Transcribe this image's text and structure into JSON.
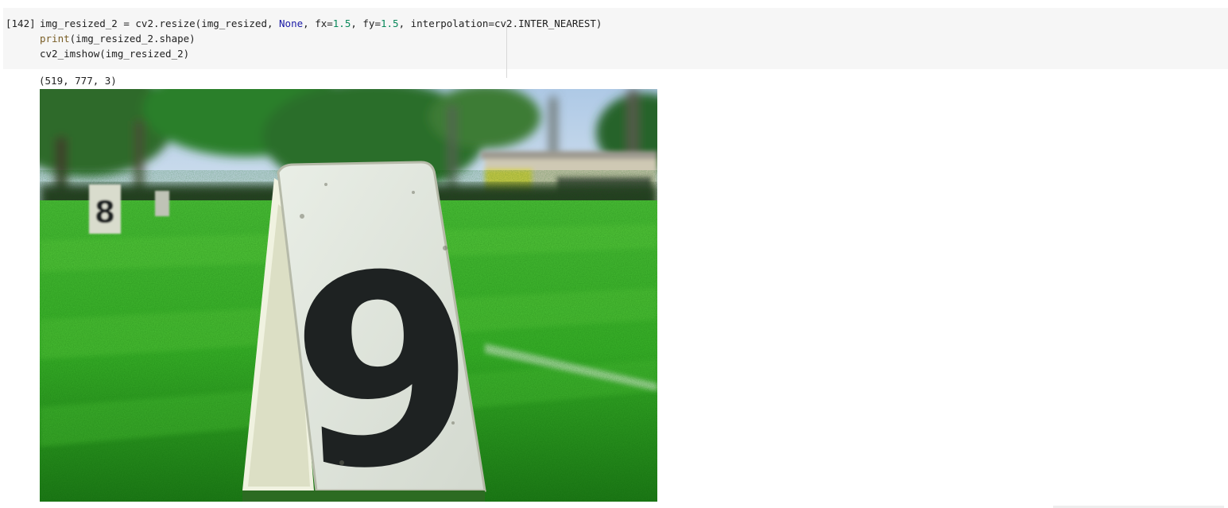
{
  "cell": {
    "execution_count": "[142]",
    "code": {
      "line1": {
        "a": "img_resized_2 = cv2.resize(img_resized, ",
        "kw_none": "None",
        "b": ", fx=",
        "n1": "1.5",
        "c": ", fy=",
        "n2": "1.5",
        "d": ", interpolation=cv2.INTER_NEAREST)"
      },
      "line2": {
        "fn": "print",
        "rest": "(img_resized_2.shape)"
      },
      "line3": "cv2_imshow(img_resized_2)"
    }
  },
  "output": {
    "shape_text": "(519, 777, 3)",
    "image": {
      "subject": "number-9-sign-on-grass",
      "sign_number": "9",
      "background_sign_number": "8"
    }
  },
  "colors": {
    "cell_background": "#f6f6f6",
    "keyword": "#1a1aa6",
    "number": "#09885a",
    "builtin": "#795e26",
    "grass": "#3db82a"
  }
}
